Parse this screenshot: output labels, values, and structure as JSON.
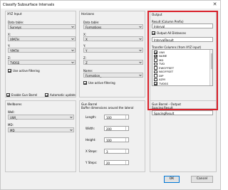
{
  "window": {
    "title": "Classify Subsurface Intervals",
    "close_glyph": "✕"
  },
  "xyz_input": {
    "group_title": "XYZ Input",
    "data_table_label": "Data table:",
    "data_table_value": "Surveys",
    "x_label": "X:",
    "x_value": "XPATH",
    "y_label": "Y:",
    "y_value": "YPATH",
    "z_label": "Z:",
    "z_value": "TVDSS",
    "use_active_filtering": "Use active filtering"
  },
  "horizons": {
    "group_title": "Horizons",
    "data_table_label": "Data table:",
    "data_table_value": "Formations",
    "x_label": "X:",
    "x_value": "X",
    "y_label": "Y:",
    "y_value": "Y",
    "z_label": "Z:",
    "z_value": "Z",
    "name_label": "Name:",
    "name_value": "Formation_",
    "use_active_filtering": "Use active filtering"
  },
  "output": {
    "group_title": "Output",
    "result_label": "Result (Column Prefix)",
    "result_value": "Interval",
    "output_all_distances": "Output All Distances",
    "interval_result_value": "IntervalResult",
    "transfer_label": "Transfer Columns (from XYZ input)",
    "transfer_items": [
      {
        "label": "UWI",
        "checked": true
      },
      {
        "label": "NAME",
        "checked": true
      },
      {
        "label": "MD",
        "checked": false
      },
      {
        "label": "TVD",
        "checked": false
      },
      {
        "label": "EWOFFSET",
        "checked": false
      },
      {
        "label": "NSOFFSET",
        "checked": false
      },
      {
        "label": "DIP",
        "checked": false
      },
      {
        "label": "AZM",
        "checked": false
      },
      {
        "label": "TVDSS",
        "checked": true
      }
    ]
  },
  "options": {
    "enable_gun_barrel": "Enable Gun Barrel",
    "automatic_update": "Automatic update"
  },
  "wellbores": {
    "group_title": "Wellbores",
    "well_label": "Well:",
    "well_value": "UWI_",
    "md_label": "MD:",
    "md_value": "MD"
  },
  "gun_barrel": {
    "group_title": "Gun Barrel",
    "subtitle": "Buffer dimensions around the lateral",
    "length_label": "Length:",
    "length_value": "100",
    "width_label": "Width:",
    "width_value": "200",
    "height_label": "Height:",
    "height_value": "100",
    "xsteps_label": "X Steps:",
    "xsteps_value": "3",
    "ysteps_label": "Y Steps:",
    "ysteps_value": "20"
  },
  "gun_barrel_output": {
    "group_title": "Gun Barrel - Output",
    "spacing_result_label": "Spacing Result",
    "spacing_result_value": "SpacingResult"
  },
  "buttons": {
    "ok": "OK",
    "cancel": "Cancel"
  },
  "colors": {
    "highlight": "#d9202a",
    "window_bg": "#f0f0f0"
  }
}
